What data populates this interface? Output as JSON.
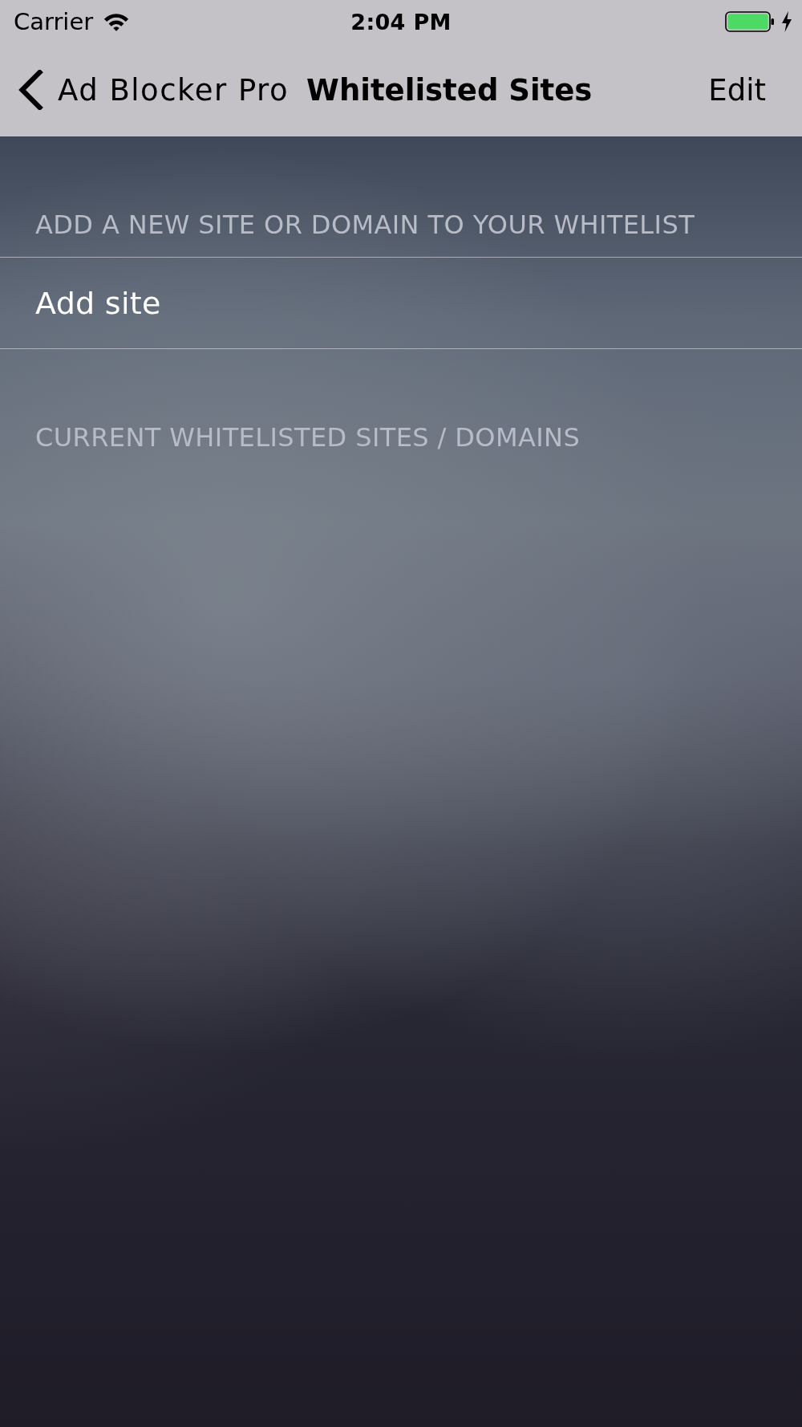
{
  "status_bar": {
    "carrier": "Carrier",
    "time": "2:04 PM",
    "charging": true
  },
  "nav_bar": {
    "back_label": "Ad Blocker Pro",
    "title": "Whitelisted Sites",
    "action": "Edit"
  },
  "sections": [
    {
      "header": "ADD A NEW SITE OR DOMAIN TO YOUR WHITELIST",
      "rows": [
        {
          "kind": "action",
          "label": "Add site"
        }
      ]
    },
    {
      "header": "CURRENT WHITELISTED SITES / DOMAINS"
    }
  ]
}
